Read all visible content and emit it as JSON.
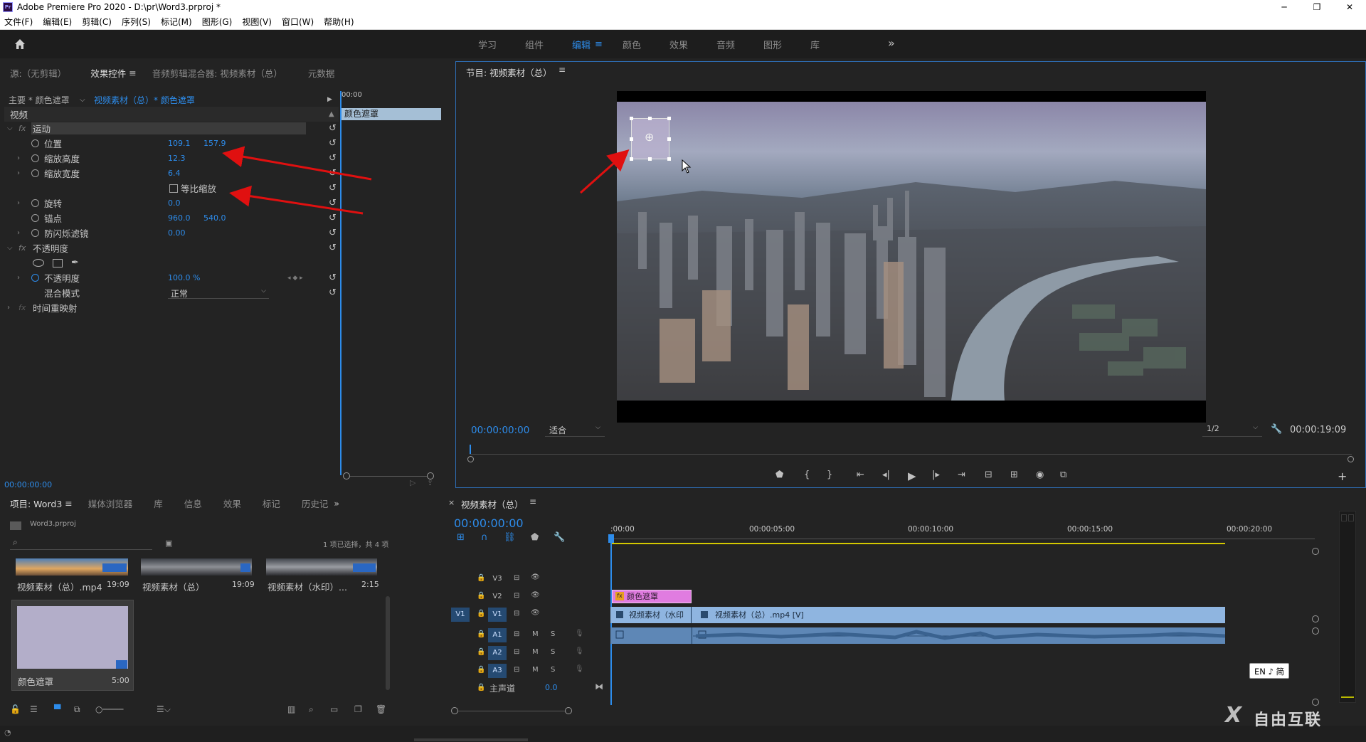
{
  "window": {
    "title": "Adobe Premiere Pro 2020 - D:\\pr\\Word3.prproj *",
    "controls": [
      "─",
      "❐",
      "✕"
    ]
  },
  "menu": [
    "文件(F)",
    "编辑(E)",
    "剪辑(C)",
    "序列(S)",
    "标记(M)",
    "图形(G)",
    "视图(V)",
    "窗口(W)",
    "帮助(H)"
  ],
  "workspaces": {
    "tabs": [
      "学习",
      "组件",
      "编辑",
      "颜色",
      "效果",
      "音频",
      "图形",
      "库"
    ],
    "active": "编辑",
    "more": "»"
  },
  "source_panel": {
    "tabs": [
      "源:（无剪辑）",
      "效果控件",
      "音频剪辑混合器: 视频素材（总）",
      "元数据"
    ],
    "active_tab": "效果控件",
    "master_label": "主要 * 颜色遮罩",
    "clip_label": "视频素材（总）* 颜色遮罩",
    "mini_timecode": "00:00",
    "clip_name": "颜色遮罩",
    "video_section": "视频",
    "motion": {
      "name": "运动",
      "position_label": "位置",
      "position_x": "109.1",
      "position_y": "157.9",
      "scale_height_label": "缩放高度",
      "scale_height": "12.3",
      "scale_width_label": "缩放宽度",
      "scale_width": "6.4",
      "uniform_scale_label": "等比缩放",
      "rotation_label": "旋转",
      "rotation": "0.0",
      "anchor_label": "锚点",
      "anchor_x": "960.0",
      "anchor_y": "540.0",
      "flicker_label": "防闪烁滤镜",
      "flicker": "0.00"
    },
    "opacity": {
      "name": "不透明度",
      "opacity_label": "不透明度",
      "opacity_value": "100.0 %",
      "blend_label": "混合模式",
      "blend_value": "正常"
    },
    "time_remap": "时间重映射",
    "footer_timecode": "00:00:00:00"
  },
  "program": {
    "title": "节目: 视频素材（总）",
    "timecode": "00:00:00:00",
    "fit": "适合",
    "resolution": "1/2",
    "duration": "00:00:19:09"
  },
  "project": {
    "tabs": [
      "项目: Word3",
      "媒体浏览器",
      "库",
      "信息",
      "效果",
      "标记",
      "历史记"
    ],
    "active_tab": "项目: Word3",
    "file": "Word3.prproj",
    "selection_info": "1 项已选择，共 4 项",
    "items": [
      {
        "name": "视频素材（总）.mp4",
        "duration": "19:09"
      },
      {
        "name": "视频素材（总）",
        "duration": "19:09"
      },
      {
        "name": "视频素材（水印）...",
        "duration": "2:15"
      },
      {
        "name": "颜色遮罩",
        "duration": "5:00"
      }
    ]
  },
  "timeline": {
    "title": "视频素材（总）",
    "timecode": "00:00:00:00",
    "ruler": [
      ":00:00",
      "00:00:05:00",
      "00:00:10:00",
      "00:00:15:00",
      "00:00:20:00"
    ],
    "tracks": {
      "v3": "V3",
      "v2": "V2",
      "v1": "V1",
      "v1_src": "V1",
      "a1": "A1",
      "a2": "A2",
      "a3": "A3",
      "master": "主声道",
      "master_value": "0.0"
    },
    "clips": {
      "matte": "颜色遮罩",
      "v1_a": "视频素材（水印",
      "v1_b": "视频素材（总）.mp4 [V]"
    },
    "ime_badge": "EN ♪ 简"
  },
  "watermark": "自由互联"
}
